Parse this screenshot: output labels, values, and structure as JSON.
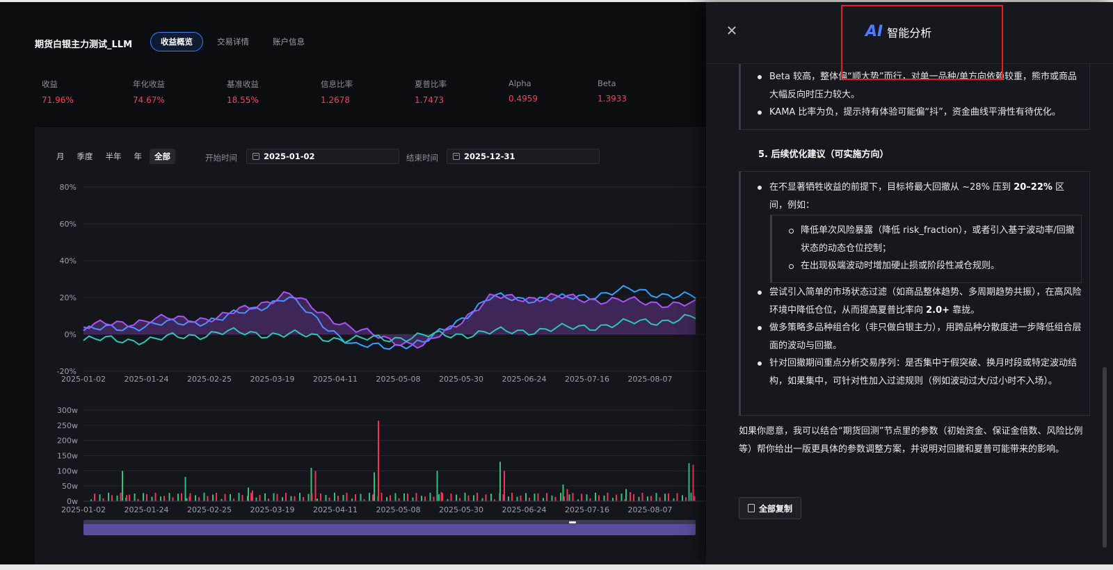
{
  "header": {
    "strategy_name": "期货白银主力测试_LLM",
    "tabs": [
      "收益概览",
      "交易详情",
      "账户信息"
    ],
    "active_tab": "收益概览"
  },
  "metrics": [
    {
      "label": "收益",
      "value": "71.96%"
    },
    {
      "label": "年化收益",
      "value": "74.67%"
    },
    {
      "label": "基准收益",
      "value": "18.55%"
    },
    {
      "label": "信息比率",
      "value": "1.2678"
    },
    {
      "label": "夏普比率",
      "value": "1.7473"
    },
    {
      "label": "Alpha",
      "value": "0.4959"
    },
    {
      "label": "Beta",
      "value": "1.3933"
    }
  ],
  "range_buttons": [
    "月",
    "季度",
    "半年",
    "年",
    "全部"
  ],
  "active_range": "全部",
  "start_label": "开始时间",
  "start_date": "2025-01-02",
  "end_label": "结束时间",
  "end_date": "2025-12-31",
  "colors": {
    "strategy": "#a855f7",
    "benchmark": "#2ea3ff",
    "excess": "#2ec4b6",
    "buy": "#2ec27e",
    "sell": "#f0325a",
    "accent": "#3a7bff"
  },
  "chart_data": [
    {
      "type": "line",
      "x": [
        "2025-01-02",
        "2025-01-24",
        "2025-02-25",
        "2025-03-19",
        "2025-04-11",
        "2025-05-08",
        "2025-05-30",
        "2025-06-24",
        "2025-07-16",
        "2025-08-07"
      ],
      "ylim": [
        -20,
        80
      ],
      "yticks": [
        "80%",
        "60%",
        "40%",
        "20%",
        "0%",
        "-20%"
      ],
      "grid": true,
      "series": [
        {
          "values": [
            2,
            5,
            8,
            20,
            -7,
            -5,
            20,
            19,
            24,
            20
          ],
          "color": "#2ea3ff"
        },
        {
          "values": [
            4,
            8,
            9,
            22,
            2,
            -7,
            20,
            20,
            18,
            16
          ],
          "color": "#a855f7"
        },
        {
          "values": [
            -3,
            -3,
            1,
            0,
            -3,
            -1,
            1,
            3,
            6,
            9
          ],
          "color": "#2ec4b6"
        }
      ]
    },
    {
      "type": "bar",
      "x": [
        "2025-01-02",
        "2025-01-24",
        "2025-02-25",
        "2025-03-19",
        "2025-04-11",
        "2025-05-08",
        "2025-05-30",
        "2025-06-24",
        "2025-07-16",
        "2025-08-07"
      ],
      "yticks": [
        "300w",
        "250w",
        "200w",
        "150w",
        "100w",
        "50w",
        "0w"
      ],
      "ylim": [
        0,
        300
      ],
      "series": [
        {
          "values": [
            100,
            80,
            45,
            110,
            95,
            100,
            130,
            55,
            40,
            125
          ],
          "color": "#2ec27e"
        },
        {
          "values": [
            20,
            15,
            35,
            100,
            265,
            30,
            100,
            40,
            30,
            120
          ],
          "color": "#f0325a"
        }
      ]
    }
  ],
  "drawer": {
    "logo": "AI",
    "title": "智能分析",
    "block1": [
      {
        "pre": "Beta 较高，整体偏“顺大势”而行，对单一品种/单方向依赖较重，熊市或商品大幅反向时压力较大。"
      },
      {
        "pre": "KAMA 比率为负，提示持有体验可能偏“抖”，资金曲线平滑性有待优化。"
      }
    ],
    "section_num": "5.",
    "section_title": "后续优化建议（可实施方向）",
    "b2_item1_pre": "在不显著牺牲收益的前提下，目标将最大回撤从 ~28% 压到 ",
    "b2_item1_bold": "20–22%",
    "b2_item1_post": " 区间，例如：",
    "sub_items": [
      "降低单次风险暴露（降低 risk_fraction），或者引入基于波动率/回撤状态的动态仓位控制；",
      "在出现极端波动时增加硬止损或阶段性减仓规则。"
    ],
    "b2_item2_pre": "尝试引入简单的市场状态过滤（如商品整体趋势、多周期趋势共振），在高风险环境中降低仓位，从而提高夏普比率向 ",
    "b2_item2_bold": "2.0+",
    "b2_item2_post": " 靠拢。",
    "b2_item3": "做多策略多品种组合化（非只做白银主力），用跨品种分散度进一步降低组合层面的波动与回撤。",
    "b2_item4": "针对回撤期间重点分析交易序列：是否集中于假突破、换月时段或特定波动结构，如果集中，可针对性加入过滤规则（例如波动过大/过小时不入场）。",
    "closing": "如果你愿意，我可以结合“期货回测”节点里的参数（初始资金、保证金倍数、风险比例等）帮你给出一版更具体的参数调整方案，并说明对回撤和夏普可能带来的影响。",
    "copy_label": "全部复制"
  }
}
